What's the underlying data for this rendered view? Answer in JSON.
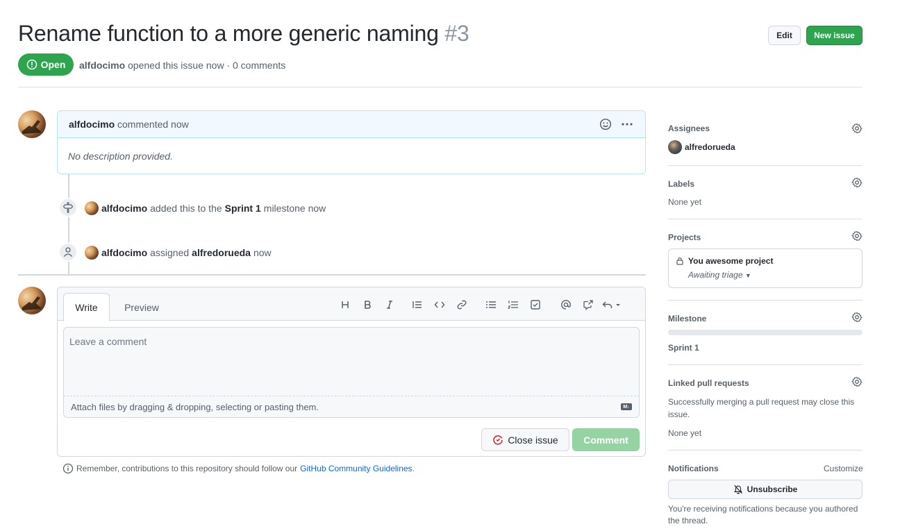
{
  "issue": {
    "title": "Rename function to a more generic naming",
    "number": "#3",
    "state": "Open",
    "author": "alfdocimo",
    "meta_rest": "opened this issue now · 0 comments"
  },
  "header": {
    "edit_label": "Edit",
    "new_issue_label": "New issue"
  },
  "comment": {
    "author": "alfdocimo",
    "action": "commented now",
    "body": "No description provided."
  },
  "timeline": [
    {
      "actor": "alfdocimo",
      "text_a": "added this to the",
      "target": "Sprint 1",
      "text_b": "milestone now"
    },
    {
      "actor": "alfdocimo",
      "text_a": "assigned",
      "target": "alfredorueda",
      "text_b": "now"
    }
  ],
  "editor": {
    "tab_write": "Write",
    "tab_preview": "Preview",
    "placeholder": "Leave a comment",
    "attach_text": "Attach files by dragging & dropping, selecting or pasting them.",
    "md_badge": "M↓",
    "close_label": "Close issue",
    "comment_label": "Comment"
  },
  "guidelines": {
    "text": "Remember, contributions to this repository should follow our",
    "link": "GitHub Community Guidelines",
    "end": "."
  },
  "sidebar": {
    "assignees": {
      "title": "Assignees",
      "value": "alfredorueda"
    },
    "labels": {
      "title": "Labels",
      "value": "None yet"
    },
    "projects": {
      "title": "Projects",
      "name": "You awesome project",
      "status": "Awaiting triage"
    },
    "milestone": {
      "title": "Milestone",
      "value": "Sprint 1",
      "progress": 0
    },
    "linked": {
      "title": "Linked pull requests",
      "desc": "Successfully merging a pull request may close this issue.",
      "value": "None yet"
    },
    "notifications": {
      "title": "Notifications",
      "customize": "Customize",
      "unsubscribe": "Unsubscribe",
      "reason": "You're receiving notifications because you authored the thread."
    }
  },
  "colors": {
    "primary": "#2da44e",
    "link": "#0969da",
    "danger": "#cf222e"
  }
}
